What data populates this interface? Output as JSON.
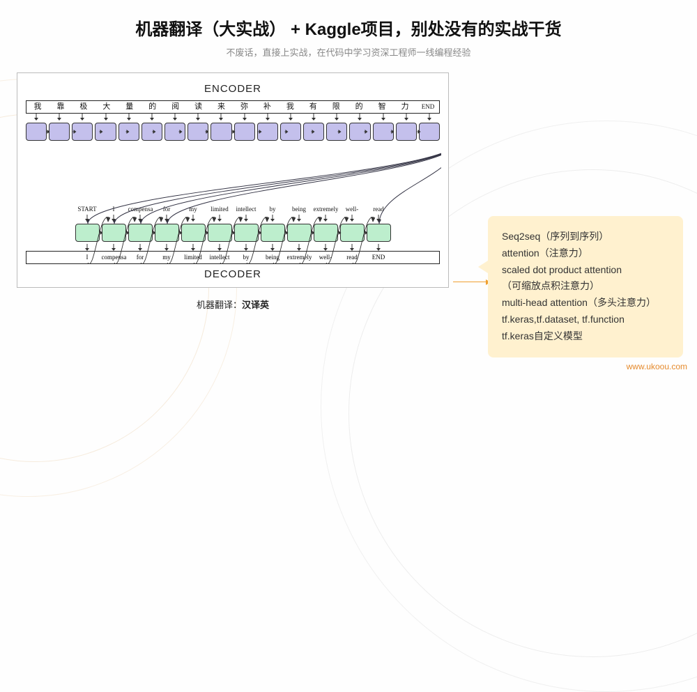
{
  "heading": "机器翻译（大实战） + Kaggle项目，别处没有的实战干货",
  "subheading": "不废话，直接上实战，在代码中学习资深工程师一线编程经验",
  "diagram": {
    "encoder_label": "ENCODER",
    "decoder_label": "DECODER",
    "encoder_tokens": [
      "我",
      "靠",
      "极",
      "大",
      "量",
      "的",
      "阅",
      "读",
      "来",
      "弥",
      "补",
      "我",
      "有",
      "限",
      "的",
      "智",
      "力",
      "END"
    ],
    "decoder_input_tokens": [
      "START",
      "I",
      "compensate",
      "for",
      "my",
      "limited",
      "intellect",
      "by",
      "being",
      "extremely",
      "well-",
      "read"
    ],
    "decoder_output_tokens": [
      "I",
      "compensate",
      "for",
      "my",
      "limited",
      "intellect",
      "by",
      "being",
      "extremely",
      "well-",
      "read",
      "END"
    ]
  },
  "caption_prefix": "机器翻译：",
  "caption_bold": "汉译英",
  "card_lines": [
    "Seq2seq（序列到序列）",
    " attention（注意力）",
    " scaled dot product attention",
    " （可缩放点积注意力）",
    "multi-head attention（多头注意力）",
    "tf.keras,tf.dataset, tf.function",
    "tf.keras自定义模型"
  ],
  "watermark": "www.ukoou.com",
  "colors": {
    "card_bg": "#fff1cf",
    "accent": "#e58a2c",
    "enc_node": "#c4c0ec",
    "dec_node": "#bdeecd"
  }
}
